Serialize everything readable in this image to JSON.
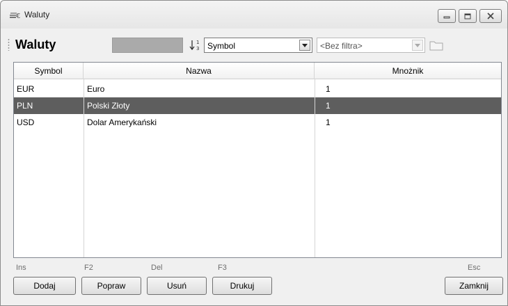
{
  "window": {
    "title": "Waluty",
    "icon": "currency-euro-icon",
    "controls": [
      "minimize-icon",
      "maximize-icon",
      "close-icon"
    ]
  },
  "toolbar": {
    "title": "Waluty",
    "sort_combo_value": "Symbol",
    "filter_combo_value": "<Bez filtra>"
  },
  "table": {
    "columns": [
      "Symbol",
      "Nazwa",
      "Mnożnik"
    ],
    "rows": [
      {
        "symbol": "EUR",
        "name": "Euro",
        "multiplier": "1"
      },
      {
        "symbol": "PLN",
        "name": "Polski Złoty",
        "multiplier": "1"
      },
      {
        "symbol": "USD",
        "name": "Dolar Amerykański",
        "multiplier": "1"
      }
    ],
    "selected_row": 1,
    "selection_color": "#5e5e5e"
  },
  "buttons": {
    "add": {
      "label": "Dodaj",
      "shortcut": "Ins"
    },
    "edit": {
      "label": "Popraw",
      "shortcut": "F2"
    },
    "delete": {
      "label": "Usuń",
      "shortcut": "Del"
    },
    "print": {
      "label": "Drukuj",
      "shortcut": "F3"
    },
    "close": {
      "label": "Zamknij",
      "shortcut": "Esc"
    }
  }
}
